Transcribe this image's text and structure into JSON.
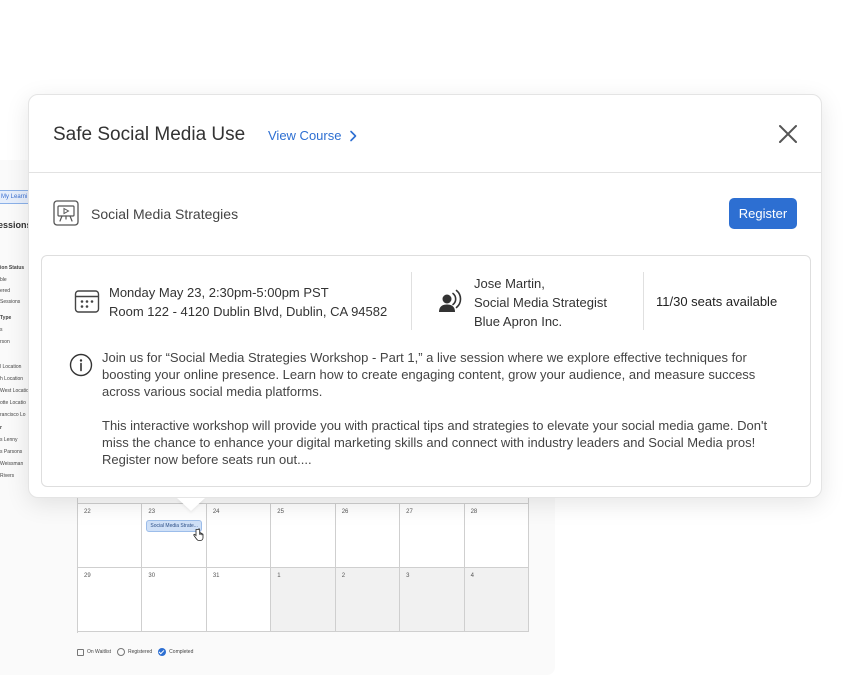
{
  "modal": {
    "title": "Safe Social Media Use",
    "view_course_label": "View Course",
    "session_name": "Social Media Strategies",
    "register_label": "Register",
    "date_line": "Monday May 23, 2:30pm-5:00pm PST",
    "location_line": "Room 122 - 4120 Dublin Blvd, Dublin, CA 94582",
    "speaker_name": "Jose Martin,",
    "speaker_title": "Social Media Strategist",
    "speaker_company": "Blue Apron Inc.",
    "seats": "11/30 seats available",
    "description_p1": "Join us for “Social Media Strategies Workshop - Part 1,” a live session where we explore effective techniques for boosting your online presence. Learn how to create engaging content, grow your audience, and measure success across various social media platforms.",
    "description_p2": "This interactive workshop will provide you with practical tips and strategies to elevate your social media game. Don't miss the chance to enhance your digital marketing skills and connect with industry leaders and Social Media pros! Register now before seats run out...."
  },
  "background": {
    "tab_label": "My Learni",
    "title": "essions",
    "filters": [
      {
        "label": "ion Status",
        "head": true
      },
      {
        "label": "ble",
        "head": false
      },
      {
        "label": "ered",
        "head": false
      },
      {
        "label": "Sessions",
        "head": false
      },
      {
        "label": "Type",
        "head": true
      },
      {
        "label": "s",
        "head": false
      },
      {
        "label": "rson",
        "head": false
      },
      {
        "label": "l Location",
        "head": false
      },
      {
        "label": "h Location",
        "head": false
      },
      {
        "label": "West Locatio",
        "head": false
      },
      {
        "label": "otte Locatio",
        "head": false
      },
      {
        "label": "rancisco Lo",
        "head": false
      },
      {
        "label": "r",
        "head": true
      },
      {
        "label": "s Lenny",
        "head": false
      },
      {
        "label": "s Parsons",
        "head": false
      },
      {
        "label": "Weissman",
        "head": false
      },
      {
        "label": "Rivers",
        "head": false
      }
    ],
    "calendar": {
      "row1": [
        "22",
        "23",
        "24",
        "25",
        "26",
        "27",
        "28"
      ],
      "row2": [
        "29",
        "30",
        "31",
        "1",
        "2",
        "3",
        "4"
      ],
      "event_label": "Social Media Strate..."
    },
    "legend": {
      "waitlist": "On Waitlist",
      "registered": "Registered",
      "completed": "Completed"
    }
  },
  "colors": {
    "accent": "#2d6fd2",
    "event_bg": "#cfe0f7"
  }
}
